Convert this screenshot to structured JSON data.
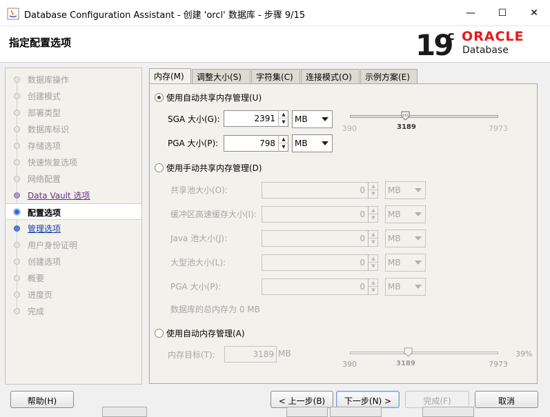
{
  "window": {
    "title": "Database Configuration Assistant - 创建 'orcl' 数据库 - 步骤 9/15",
    "minimize": "—",
    "maximize": "☐",
    "close": "✕"
  },
  "header": {
    "page_title": "指定配置选项",
    "logo_19": "19",
    "logo_c": "c",
    "logo_oracle": "ORACLE",
    "logo_database": "Database"
  },
  "nav": {
    "items": [
      {
        "label": "数据库操作",
        "state": "disabled"
      },
      {
        "label": "创建模式",
        "state": "disabled"
      },
      {
        "label": "部署类型",
        "state": "disabled"
      },
      {
        "label": "数据库标识",
        "state": "disabled"
      },
      {
        "label": "存储选项",
        "state": "disabled"
      },
      {
        "label": "快速恢复选项",
        "state": "disabled"
      },
      {
        "label": "网络配置",
        "state": "disabled"
      },
      {
        "label": "Data Vault 选项",
        "state": "done"
      },
      {
        "label": "配置选项",
        "state": "active"
      },
      {
        "label": "管理选项",
        "state": "next"
      },
      {
        "label": "用户身份证明",
        "state": "disabled"
      },
      {
        "label": "创建选项",
        "state": "disabled"
      },
      {
        "label": "概要",
        "state": "disabled"
      },
      {
        "label": "进度页",
        "state": "disabled"
      },
      {
        "label": "完成",
        "state": "disabled"
      }
    ]
  },
  "tabs": [
    {
      "label": "内存(M)",
      "active": true
    },
    {
      "label": "调整大小(S)",
      "active": false
    },
    {
      "label": "字符集(C)",
      "active": false
    },
    {
      "label": "连接模式(O)",
      "active": false
    },
    {
      "label": "示例方案(E)",
      "active": false
    }
  ],
  "memory": {
    "auto_shared": {
      "label": "使用自动共享内存管理(U)",
      "checked": true,
      "sga_label": "SGA 大小(G):",
      "sga_value": "2391",
      "sga_unit": "MB",
      "pga_label": "PGA 大小(P):",
      "pga_value": "798",
      "pga_unit": "MB",
      "slider_min": "390",
      "slider_current": "3189",
      "slider_max": "7973",
      "slider_fraction": 0.37
    },
    "manual_shared": {
      "label": "使用手动共享内存管理(D)",
      "checked": false,
      "fields": [
        {
          "label": "共享池大小(O):",
          "value": "0",
          "unit": "MB"
        },
        {
          "label": "缓冲区高速缓存大小(I):",
          "value": "0",
          "unit": "MB"
        },
        {
          "label": "Java 池大小(J):",
          "value": "0",
          "unit": "MB"
        },
        {
          "label": "大型池大小(L):",
          "value": "0",
          "unit": "MB"
        },
        {
          "label": "PGA 大小(P):",
          "value": "0",
          "unit": "MB"
        }
      ],
      "total_text": "数据库的总内存为 0 MB"
    },
    "auto_memory": {
      "label": "使用自动内存管理(A)",
      "checked": false,
      "target_label": "内存目标(T):",
      "target_value": "3189",
      "target_unit": "MB",
      "slider_min": "390",
      "slider_current": "3189",
      "slider_max": "7973",
      "percent": "39%",
      "slider_fraction": 0.39
    }
  },
  "footer": {
    "help": "帮助(H)",
    "back": "< 上一步(B)",
    "next": "下一步(N) >",
    "finish": "完成(F)",
    "cancel": "取消"
  }
}
